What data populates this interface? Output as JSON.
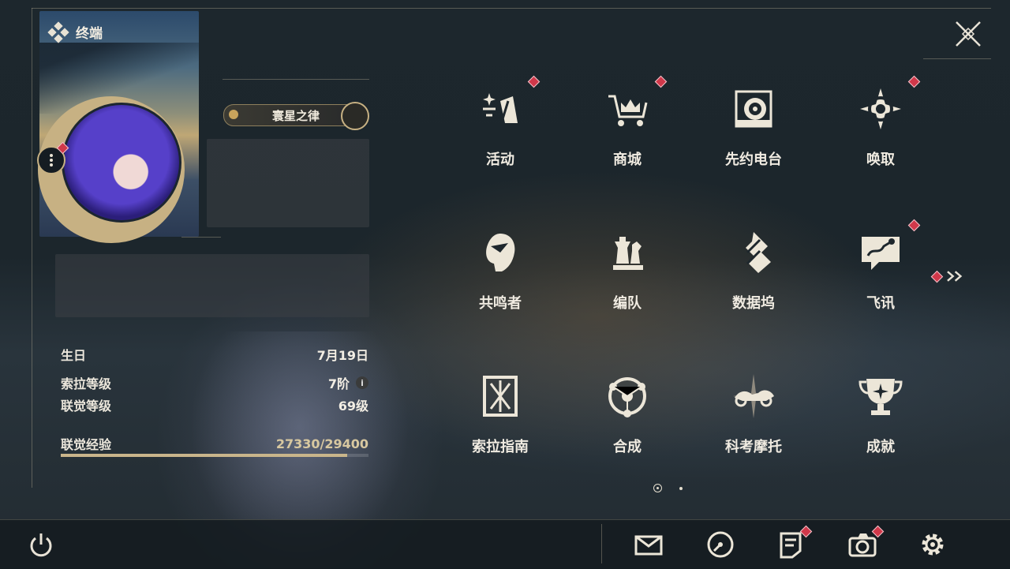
{
  "panel": {
    "title": "终端",
    "player_title": "寰星之律",
    "stats": [
      {
        "label": "生日",
        "value": "7月19日"
      },
      {
        "label": "索拉等级",
        "value": "7阶"
      },
      {
        "label": "联觉等级",
        "value": "69级"
      }
    ],
    "experience": {
      "label": "联觉经验",
      "value": "27330/29400",
      "progress": 0.9296
    }
  },
  "menu": {
    "items": [
      {
        "label": "活动",
        "icon": "activity-icon",
        "badge": true
      },
      {
        "label": "商城",
        "icon": "shop-cart-icon",
        "badge": true
      },
      {
        "label": "先约电台",
        "icon": "radio-record-icon",
        "badge": false
      },
      {
        "label": "唤取",
        "icon": "convene-compass-icon",
        "badge": true
      },
      {
        "label": "共鸣者",
        "icon": "resonator-head-icon",
        "badge": false
      },
      {
        "label": "编队",
        "icon": "chess-team-icon",
        "badge": false
      },
      {
        "label": "数据坞",
        "icon": "data-dock-icon",
        "badge": false
      },
      {
        "label": "飞讯",
        "icon": "chat-message-icon",
        "badge": true
      },
      {
        "label": "索拉指南",
        "icon": "guidebook-icon",
        "badge": false
      },
      {
        "label": "合成",
        "icon": "synthesis-icon",
        "badge": false
      },
      {
        "label": "科考摩托",
        "icon": "motorcycle-icon",
        "badge": false
      },
      {
        "label": "成就",
        "icon": "trophy-icon",
        "badge": false
      }
    ],
    "page": {
      "current": 1,
      "total": 2
    }
  },
  "bottom_bar": {
    "items": [
      {
        "icon": "mail-icon",
        "badge": false
      },
      {
        "icon": "clock-icon",
        "badge": false
      },
      {
        "icon": "notice-icon",
        "badge": true
      },
      {
        "icon": "camera-icon",
        "badge": true
      },
      {
        "icon": "settings-gear-icon",
        "badge": false
      }
    ]
  },
  "colors": {
    "accent": "#c9b58b",
    "badge": "#d0384a",
    "text": "#f0ebe1"
  }
}
